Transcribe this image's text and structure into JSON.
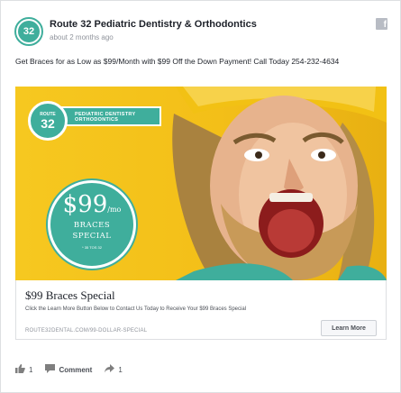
{
  "post": {
    "page_name": "Route 32 Pediatric Dentistry & Orthodontics",
    "time": "about 2 months ago",
    "text": "Get Braces for as Low as $99/Month with $99 Off the Down Payment! Call Today 254-232-4634",
    "avatar_text": "32"
  },
  "image": {
    "logo_badge_small": "ROUTE",
    "logo_badge_number": "32",
    "logo_bar_line1": "PEDIATRIC DENTISTRY",
    "logo_bar_line2": "ORTHODONTICS",
    "price_main": "$99",
    "price_suffix": "/mo",
    "price_line1": "BRACES",
    "price_line2": "SPECIAL",
    "price_fine": "* 35 TOS 32"
  },
  "link": {
    "title": "$99 Braces Special",
    "description": "Click the Learn More Button Below to Contact Us Today to Receive Your $99 Braces Special",
    "url": "ROUTE32DENTAL.COM/99-DOLLAR-SPECIAL",
    "button_label": "Learn More"
  },
  "footer": {
    "like_count": "1",
    "comment_label": "Comment",
    "share_count": "1"
  },
  "colors": {
    "brand_teal": "#3fae9c",
    "image_yellow": "#f6c820"
  },
  "icons": {
    "facebook": "facebook-icon",
    "like": "thumbs-up-icon",
    "comment": "comment-icon",
    "share": "share-arrow-icon"
  }
}
